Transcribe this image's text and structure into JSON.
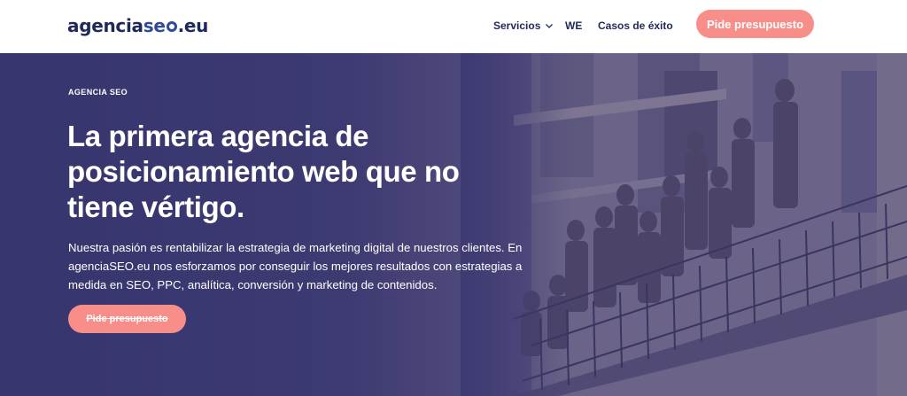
{
  "header": {
    "logo": {
      "part1": "agencia",
      "part2": "se",
      "part3": ".eu",
      "icon": "magnifier-icon"
    },
    "nav": [
      {
        "label": "Servicios",
        "has_dropdown": true
      },
      {
        "label": "WE"
      },
      {
        "label": "Casos de éxito"
      }
    ],
    "cta_label": "Pide presupuesto"
  },
  "hero": {
    "eyebrow": "AGENCIA SEO",
    "headline_lines": [
      "La primera agencia de",
      "posicionamiento web que no",
      "tiene vértigo."
    ],
    "lead_lines": [
      "Nuestra pasión es rentabilizar la estrategia de marketing digital de nuestros clientes. En",
      "agenciaSEO.eu nos esforzamos por conseguir los mejores resultados con estrategias a",
      "medida en SEO, PPC, analítica, conversión y marketing de contenidos."
    ],
    "cta_label": "Pide presupuesto",
    "image": "team-on-balcony-photo"
  },
  "colors": {
    "brand_navy": "#1f2a5c",
    "brand_blue": "#2e4b9c",
    "cta_coral": "#f88e8a",
    "hero_overlay": "#3d3a72"
  }
}
